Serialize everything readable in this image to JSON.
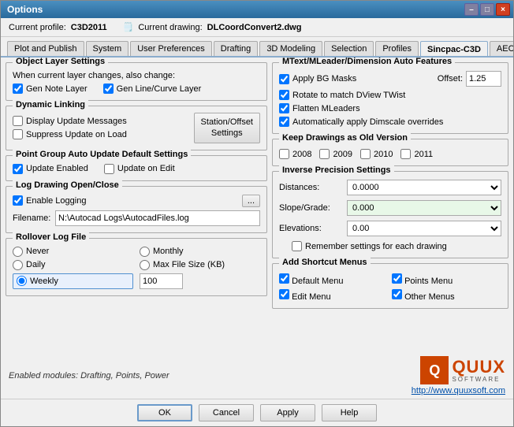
{
  "window": {
    "title": "Options",
    "close_btn": "×",
    "min_btn": "–",
    "max_btn": "□"
  },
  "profile_bar": {
    "current_profile_label": "Current profile:",
    "current_profile_value": "C3D2011",
    "current_drawing_label": "Current drawing:",
    "current_drawing_value": "DLCoordConvert2.dwg"
  },
  "tabs": [
    {
      "label": "Plot and Publish"
    },
    {
      "label": "System"
    },
    {
      "label": "User Preferences"
    },
    {
      "label": "Drafting"
    },
    {
      "label": "3D Modeling"
    },
    {
      "label": "Selection"
    },
    {
      "label": "Profiles"
    },
    {
      "label": "Sincpac-C3D",
      "active": true
    },
    {
      "label": "AEC Editor"
    }
  ],
  "left": {
    "object_layer": {
      "title": "Object Layer Settings",
      "when_label": "When current layer changes, also change:",
      "gen_note": "Gen Note Layer",
      "gen_line": "Gen Line/Curve Layer"
    },
    "dynamic_linking": {
      "title": "Dynamic Linking",
      "display_update": "Display Update Messages",
      "suppress_update": "Suppress Update on Load",
      "station_btn_line1": "Station/Offset",
      "station_btn_line2": "Settings"
    },
    "point_group": {
      "title": "Point Group Auto Update Default Settings",
      "update_enabled": "Update Enabled",
      "update_on_edit": "Update on Edit"
    },
    "log_drawing": {
      "title": "Log Drawing Open/Close",
      "enable_logging": "Enable Logging",
      "browse_btn": "...",
      "filename_label": "Filename:",
      "filename_value": "N:\\Autocad Logs\\AutocadFiles.log"
    },
    "rollover": {
      "title": "Rollover Log File",
      "never": "Never",
      "monthly": "Monthly",
      "daily": "Daily",
      "max_file": "Max File Size (KB)",
      "weekly": "Weekly",
      "weekly_value": "100"
    }
  },
  "right": {
    "mtext": {
      "title": "MText/MLeader/Dimension Auto Features",
      "apply_bg": "Apply BG Masks",
      "offset_label": "Offset:",
      "offset_value": "1.25",
      "rotate_match": "Rotate to match DView TWist",
      "flatten": "Flatten MLeaders",
      "auto_dimscale": "Automatically apply Dimscale overrides"
    },
    "keep_drawings": {
      "title": "Keep Drawings as Old Version",
      "years": [
        "2008",
        "2009",
        "2010",
        "2011"
      ]
    },
    "inverse_precision": {
      "title": "Inverse Precision Settings",
      "distances_label": "Distances:",
      "distances_value": "0.0000",
      "slope_label": "Slope/Grade:",
      "slope_value": "0.000",
      "elevations_label": "Elevations:",
      "elevations_value": "0.00",
      "remember": "Remember settings for each drawing"
    },
    "shortcut_menus": {
      "title": "Add Shortcut Menus",
      "default_menu": "Default Menu",
      "points_menu": "Points Menu",
      "edit_menu": "Edit Menu",
      "other_menus": "Other Menus"
    }
  },
  "bottom": {
    "enabled_label": "Enabled modules:",
    "enabled_modules": "Drafting, Points, Power",
    "link": "http://www.quuxsoft.com",
    "quux": "QUUX",
    "software": "SOFTWARE"
  },
  "footer": {
    "ok": "OK",
    "cancel": "Cancel",
    "apply": "Apply",
    "help": "Help"
  }
}
